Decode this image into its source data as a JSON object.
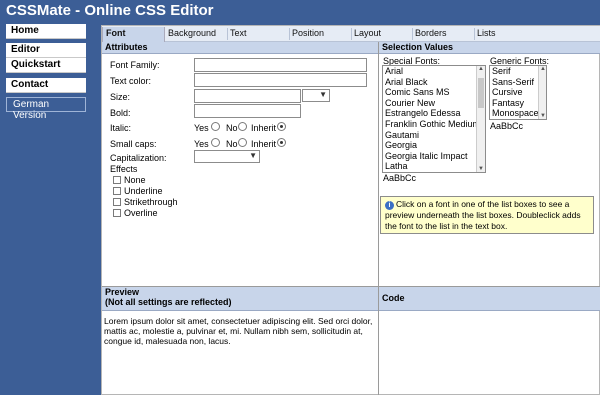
{
  "app": {
    "title": "CSSMate - Online CSS Editor"
  },
  "nav": {
    "home": "Home",
    "editor": "Editor",
    "quickstart": "Quickstart",
    "contact": "Contact",
    "german": "German Version"
  },
  "tabs": [
    "Font",
    "Background",
    "Text",
    "Position",
    "Layout",
    "Borders",
    "Lists"
  ],
  "attributes": {
    "header": "Attributes",
    "font_family": "Font Family:",
    "text_color": "Text color:",
    "size": "Size:",
    "bold": "Bold:",
    "italic": "Italic:",
    "small_caps": "Small caps:",
    "capitalization": "Capitalization:",
    "effects": "Effects",
    "yes": "Yes",
    "no": "No",
    "inherit": "Inherit",
    "effect_items": [
      "None",
      "Underline",
      "Strikethrough",
      "Overline"
    ]
  },
  "selection": {
    "header": "Selection Values",
    "special_label": "Special Fonts:",
    "generic_label": "Generic Fonts:",
    "special_fonts": [
      "Arial",
      "Arial Black",
      "Comic Sans MS",
      "Courier New",
      "Estrangelo Edessa",
      "Franklin Gothic Medium",
      "Gautami",
      "Georgia",
      "Georgia Italic Impact",
      "Latha"
    ],
    "generic_fonts": [
      "Serif",
      "Sans-Serif",
      "Cursive",
      "Fantasy",
      "Monospace"
    ],
    "special_sample": "AaBbCc",
    "generic_sample": "AaBbCc",
    "info": "Click on a font in one of the list boxes to see a preview underneath the list boxes. Doubleclick adds the font to the list in the text box."
  },
  "preview": {
    "header_line1": "Preview",
    "header_line2": "(Not all settings are reflected)",
    "text": "Lorem ipsum dolor sit amet, consectetuer adipiscing elit. Sed orci dolor, mattis ac, molestie a, pulvinar et, mi. Nullam nibh sem, sollicitudin at, congue id, malesuada non, lacus."
  },
  "code": {
    "header": "Code"
  },
  "colors": {
    "brand": "#3C5E96",
    "panel_header": "#C8D5EA",
    "info_bg": "#FFFFCC"
  }
}
